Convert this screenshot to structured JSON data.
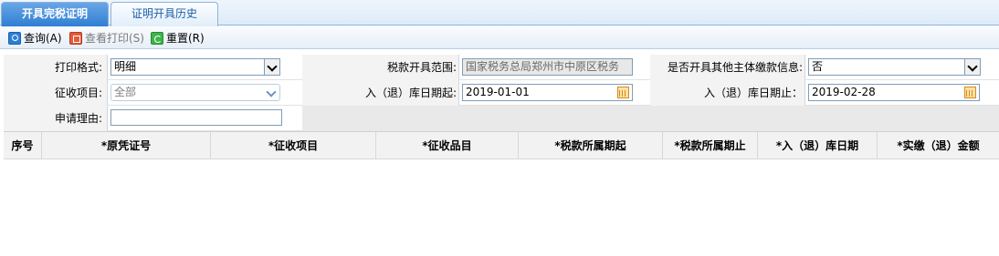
{
  "tabs": [
    {
      "label": "开具完税证明"
    },
    {
      "label": "证明开具历史"
    }
  ],
  "toolbar": {
    "query_label": "查询(A)",
    "print_label": "查看打印(S)",
    "reset_label": "重置(R)"
  },
  "form": {
    "print_format_label": "打印格式:",
    "print_format_value": "明细",
    "tax_scope_label": "税款开具范围:",
    "tax_scope_value": "国家税务总局郑州市中原区税务",
    "other_payer_label": "是否开具其他主体缴款信息:",
    "other_payer_value": "否",
    "levy_item_label": "征收项目:",
    "levy_item_value": "全部",
    "date_start_label": "入（退）库日期起:",
    "date_start_value": "2019-01-01",
    "date_end_label": "入（退）库日期止：",
    "date_end_value": "2019-02-28",
    "reason_label": "申请理由:",
    "reason_value": ""
  },
  "grid": {
    "columns": [
      "序号",
      "*原凭证号",
      "*征收项目",
      "*征收品目",
      "*税款所属期起",
      "*税款所属期止",
      "*入（退）库日期",
      "*实缴（退）金额"
    ]
  },
  "colors": {
    "tab_active": "#2f7fd3",
    "border": "#7f9db9"
  },
  "icons": [
    "search-icon",
    "print-icon",
    "reset-icon",
    "dropdown-arrow-icon",
    "calendar-icon"
  ]
}
